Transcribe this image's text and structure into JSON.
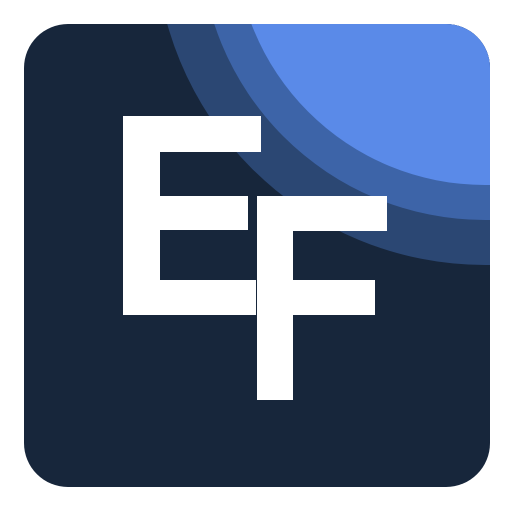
{
  "app_icon": {
    "monogram": "EF",
    "colors": {
      "page_background": "#ffffff",
      "tile_background": "#17263b",
      "band_outer": "#2b4773",
      "band_middle": "#3d64a8",
      "band_inner": "#5a8ae8",
      "monogram_fill": "#ffffff"
    }
  }
}
